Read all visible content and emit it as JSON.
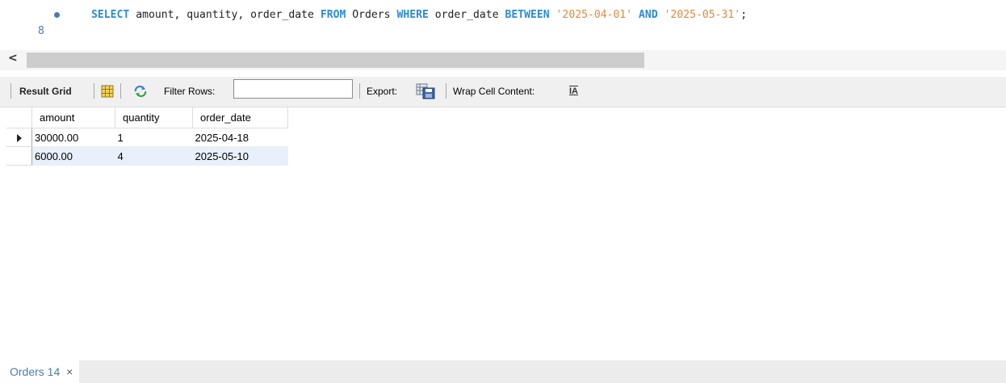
{
  "editor": {
    "line_number": "8",
    "sql_tokens": [
      {
        "t": "SELECT",
        "c": "kw"
      },
      {
        "t": " amount, quantity, order_date ",
        "c": ""
      },
      {
        "t": "FROM",
        "c": "kw"
      },
      {
        "t": " Orders ",
        "c": ""
      },
      {
        "t": "WHERE",
        "c": "kw"
      },
      {
        "t": " order_date ",
        "c": ""
      },
      {
        "t": "BETWEEN",
        "c": "kw"
      },
      {
        "t": " ",
        "c": ""
      },
      {
        "t": "'2025-04-01'",
        "c": "str"
      },
      {
        "t": " ",
        "c": ""
      },
      {
        "t": "AND",
        "c": "kw"
      },
      {
        "t": " ",
        "c": ""
      },
      {
        "t": "'2025-05-31'",
        "c": "str"
      },
      {
        "t": ";",
        "c": ""
      }
    ]
  },
  "scrollbar": {
    "left_arrow": "<"
  },
  "toolbar": {
    "result_grid_label": "Result Grid",
    "filter_label": "Filter Rows:",
    "filter_value": "",
    "export_label": "Export:",
    "wrap_label": "Wrap Cell Content:",
    "wrap_icon_text": "IA"
  },
  "grid": {
    "columns": [
      "amount",
      "quantity",
      "order_date"
    ],
    "rows": [
      [
        "30000.00",
        "1",
        "2025-04-18"
      ],
      [
        "6000.00",
        "4",
        "2025-05-10"
      ]
    ],
    "selected_row": 0
  },
  "tabs": [
    {
      "label": "Orders 14",
      "close": "×"
    }
  ],
  "colors": {
    "keyword": "#2c8bd9",
    "string": "#e08a3f",
    "line_number": "#4a7cab",
    "selected_row_bg": "#e8f0fb"
  }
}
